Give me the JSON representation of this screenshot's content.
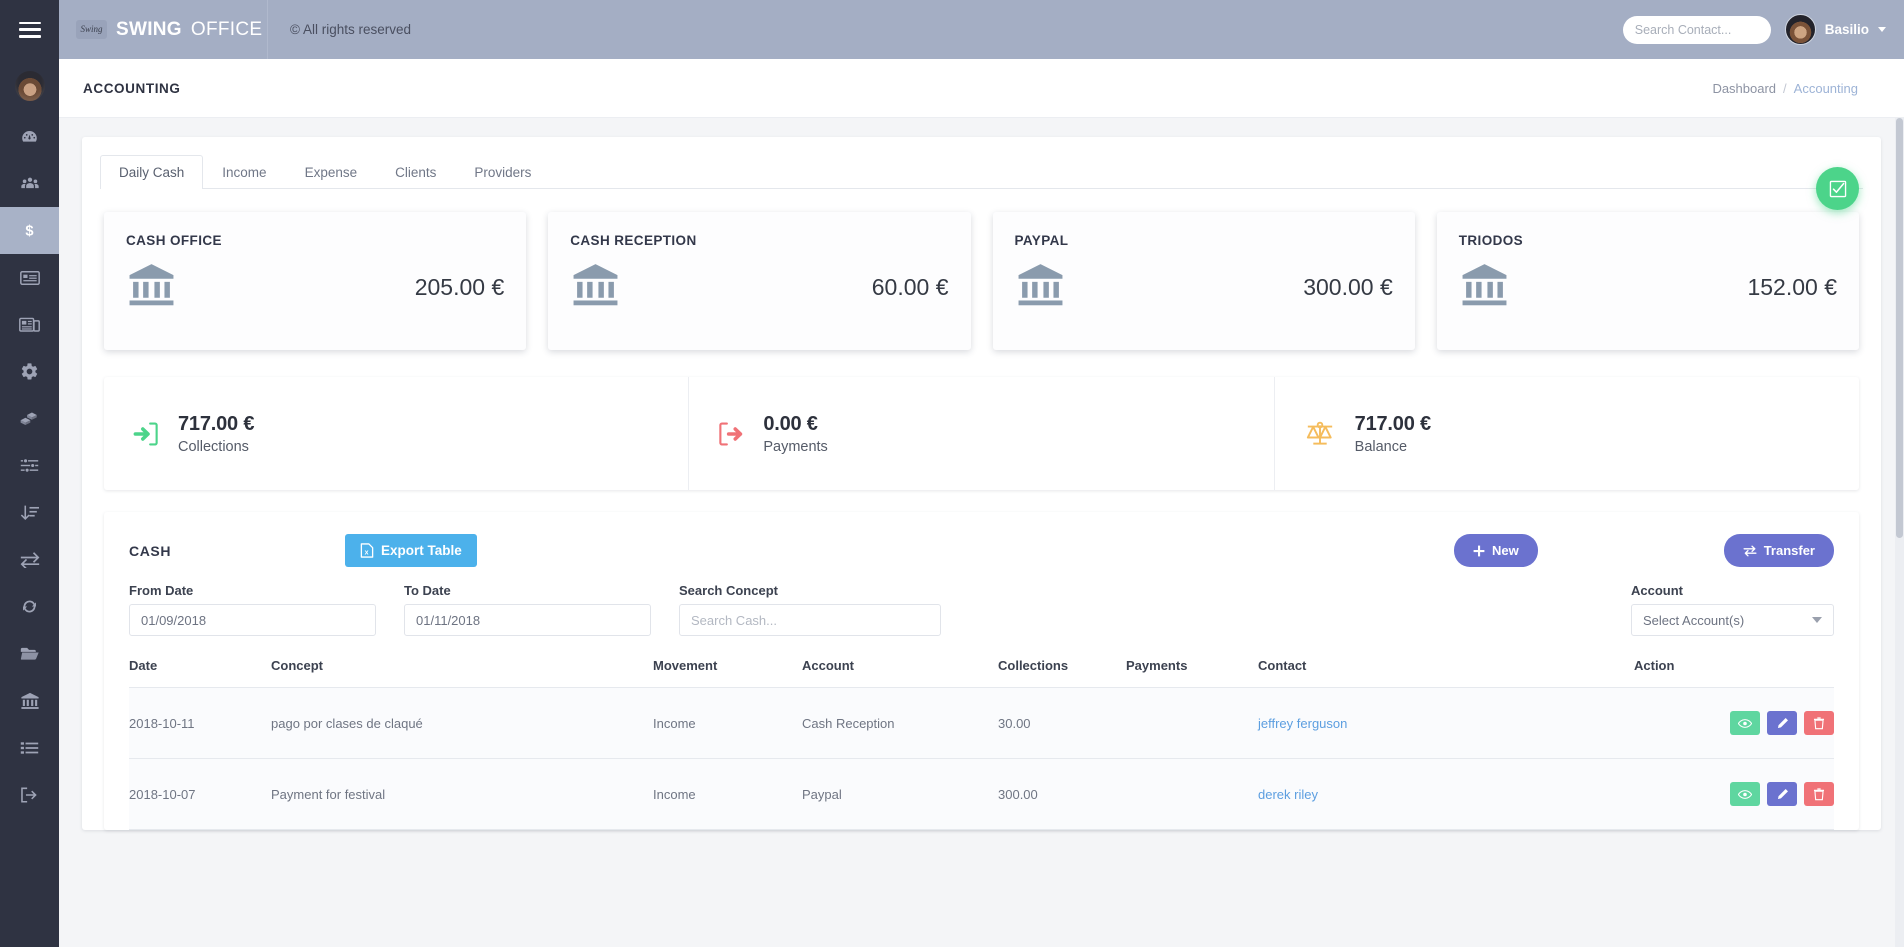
{
  "topbar": {
    "menu_icon": "hamburger-icon",
    "brand_logo_text": "Swing",
    "brand_name": "SWING",
    "brand_sub": "OFFICE",
    "copyright": "© All rights reserved",
    "search_placeholder": "Search Contact...",
    "search_value": "",
    "search_icon": "search-icon",
    "user_name": "Basilio",
    "user_caret_icon": "chevron-down-icon"
  },
  "sidebar": {
    "avatar": "user-avatar",
    "items": [
      {
        "name": "dashboard",
        "icon": "speedometer-icon",
        "active": false
      },
      {
        "name": "contacts",
        "icon": "users-icon",
        "active": false
      },
      {
        "name": "accounting",
        "icon": "dollar-icon",
        "active": true
      },
      {
        "name": "invoices",
        "icon": "list-card-icon",
        "active": false
      },
      {
        "name": "news",
        "icon": "newspaper-icon",
        "active": false
      },
      {
        "name": "settings",
        "icon": "gear-icon",
        "active": false
      },
      {
        "name": "products",
        "icon": "boxes-icon",
        "active": false
      },
      {
        "name": "filters",
        "icon": "sliders-icon",
        "active": false
      },
      {
        "name": "sort",
        "icon": "sort-amount-icon",
        "active": false
      },
      {
        "name": "transfers",
        "icon": "exchange-icon",
        "active": false
      },
      {
        "name": "sync",
        "icon": "refresh-icon",
        "active": false
      },
      {
        "name": "folders",
        "icon": "folder-icon",
        "active": false
      },
      {
        "name": "bank",
        "icon": "bank-icon",
        "active": false
      },
      {
        "name": "records",
        "icon": "list-icon",
        "active": false
      },
      {
        "name": "logout",
        "icon": "sign-out-icon",
        "active": false
      }
    ]
  },
  "pagehead": {
    "title": "ACCOUNTING",
    "breadcrumb_parent": "Dashboard",
    "breadcrumb_sep": "/",
    "breadcrumb_current": "Accounting"
  },
  "tabs": [
    {
      "label": "Daily Cash",
      "active": true
    },
    {
      "label": "Income",
      "active": false
    },
    {
      "label": "Expense",
      "active": false
    },
    {
      "label": "Clients",
      "active": false
    },
    {
      "label": "Providers",
      "active": false
    }
  ],
  "accounts": [
    {
      "title": "CASH OFFICE",
      "amount": "205.00 €",
      "icon": "bank-icon"
    },
    {
      "title": "CASH RECEPTION",
      "amount": "60.00 €",
      "icon": "bank-icon"
    },
    {
      "title": "PAYPAL",
      "amount": "300.00 €",
      "icon": "bank-icon"
    },
    {
      "title": "TRIODOS",
      "amount": "152.00 €",
      "icon": "bank-icon"
    }
  ],
  "fab": {
    "icon": "check-square-icon",
    "color": "#4cd48a"
  },
  "summary": [
    {
      "value": "717.00 €",
      "label": "Collections",
      "icon": "arrow-into-box-icon",
      "color": "#4cd48a"
    },
    {
      "value": "0.00 €",
      "label": "Payments",
      "icon": "arrow-out-of-box-icon",
      "color": "#f07277"
    },
    {
      "value": "717.00 €",
      "label": "Balance",
      "icon": "balance-scale-icon",
      "color": "#f5b councils"
    }
  ],
  "cash_panel": {
    "title": "CASH",
    "export_label": "Export Table",
    "export_icon": "excel-file-icon",
    "new_label": "New",
    "new_icon": "plus-icon",
    "transfer_label": "Transfer",
    "transfer_icon": "exchange-icon",
    "filters": {
      "from_label": "From Date",
      "from_value": "01/09/2018",
      "to_label": "To Date",
      "to_value": "01/11/2018",
      "concept_label": "Search Concept",
      "concept_placeholder": "Search Cash...",
      "concept_value": "",
      "account_label": "Account",
      "account_placeholder": "Select Account(s)",
      "account_caret_icon": "chevron-down-icon"
    },
    "columns": [
      "Date",
      "Concept",
      "Movement",
      "Account",
      "Collections",
      "Payments",
      "Contact",
      "Action"
    ],
    "rows": [
      {
        "date": "2018-10-11",
        "concept": "pago por clases de claqué",
        "movement": "Income",
        "account": "Cash Reception",
        "collections": "30.00",
        "payments": "",
        "contact": "jeffrey ferguson"
      },
      {
        "date": "2018-10-07",
        "concept": "Payment for festival",
        "movement": "Income",
        "account": "Paypal",
        "collections": "300.00",
        "payments": "",
        "contact": "derek riley"
      }
    ],
    "row_actions": [
      {
        "name": "view",
        "icon": "eye-icon",
        "color": "#5fd6a0"
      },
      {
        "name": "edit",
        "icon": "pencil-icon",
        "color": "#6b72cf"
      },
      {
        "name": "delete",
        "icon": "trash-icon",
        "color": "#f07277"
      }
    ]
  }
}
